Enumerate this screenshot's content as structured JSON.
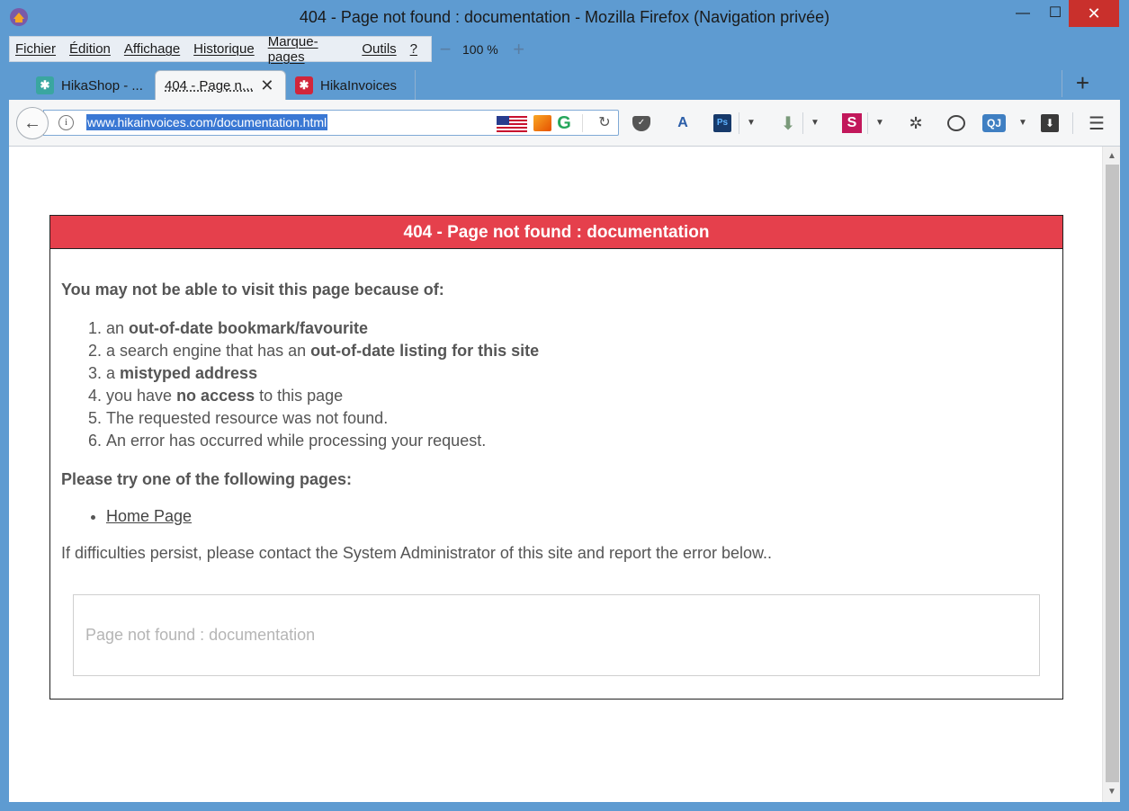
{
  "window": {
    "title": "404 - Page not found : documentation - Mozilla Firefox (Navigation privée)",
    "minimize_label": "—",
    "maximize_label": "☐",
    "close_label": "✕"
  },
  "menubar": {
    "items": [
      "Fichier",
      "Édition",
      "Affichage",
      "Historique",
      "Marque-pages",
      "Outils",
      "?"
    ],
    "zoom_out": "−",
    "zoom_level": "100 %",
    "zoom_in": "+"
  },
  "tabs": [
    {
      "label": "HikaShop - ...",
      "favicon": "hikashop-icon",
      "active": false
    },
    {
      "label": "404 - Page n...",
      "favicon": null,
      "active": true
    },
    {
      "label": "HikaInvoices",
      "favicon": "hikainvoices-icon",
      "active": false
    }
  ],
  "newtab_label": "+",
  "navbar": {
    "url": "www.hikainvoices.com/documentation.html",
    "icons": [
      "back-arrow-icon",
      "info-icon",
      "us-flag-icon",
      "extension-icon",
      "grammarly-icon",
      "reload-icon",
      "pocket-icon",
      "translate-icon",
      "photoshop-icon",
      "download-arrow-icon",
      "s-extension-icon",
      "bug-icon",
      "chat-icon",
      "qj-icon",
      "downloads-icon",
      "hamburger-menu-icon"
    ]
  },
  "page": {
    "header": "404 - Page not found : documentation",
    "intro": "You may not be able to visit this page because of:",
    "reasons": [
      {
        "prefix": "an ",
        "bold": "out-of-date bookmark/favourite",
        "suffix": ""
      },
      {
        "prefix": "a search engine that has an ",
        "bold": "out-of-date listing for this site",
        "suffix": ""
      },
      {
        "prefix": "a ",
        "bold": "mistyped address",
        "suffix": ""
      },
      {
        "prefix": "you have ",
        "bold": "no access",
        "suffix": " to this page"
      },
      {
        "prefix": "The requested resource was not found.",
        "bold": "",
        "suffix": ""
      },
      {
        "prefix": "An error has occurred while processing your request.",
        "bold": "",
        "suffix": ""
      }
    ],
    "try_heading": "Please try one of the following pages:",
    "links": [
      "Home Page"
    ],
    "persist_text": "If difficulties persist, please contact the System Administrator of this site and report the error below..",
    "error_message": "Page not found : documentation"
  },
  "colors": {
    "header_red": "#e5404c",
    "window_blue": "#5e9bd1",
    "url_highlight": "#3a78d4"
  }
}
